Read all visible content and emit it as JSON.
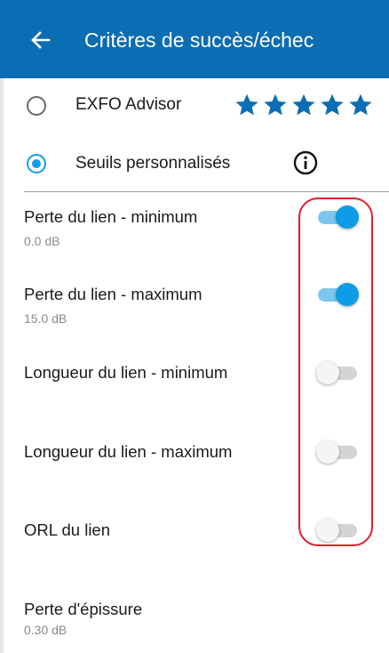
{
  "header": {
    "title": "Critères de succès/échec",
    "back_icon": "arrow-left-icon",
    "bg_color": "#0b6db4"
  },
  "options": [
    {
      "label": "EXFO Advisor",
      "selected": false,
      "rating_stars": 5
    },
    {
      "label": "Seuils personnalisés",
      "selected": true,
      "info_icon": "info-icon"
    }
  ],
  "settings": [
    {
      "label": "Perte du lien - minimum",
      "value": "0.0 dB",
      "enabled": true
    },
    {
      "label": "Perte du lien - maximum",
      "value": "15.0 dB",
      "enabled": true
    },
    {
      "label": "Longueur du lien - minimum",
      "value": null,
      "enabled": false
    },
    {
      "label": "Longueur du lien - maximum",
      "value": null,
      "enabled": false
    },
    {
      "label": "ORL du lien",
      "value": null,
      "enabled": false
    },
    {
      "label": "Perte d'épissure",
      "value": "0.30 dB",
      "enabled": null
    }
  ],
  "colors": {
    "accent": "#129ee6",
    "star": "#0b6db4",
    "highlight": "#e0202c"
  }
}
